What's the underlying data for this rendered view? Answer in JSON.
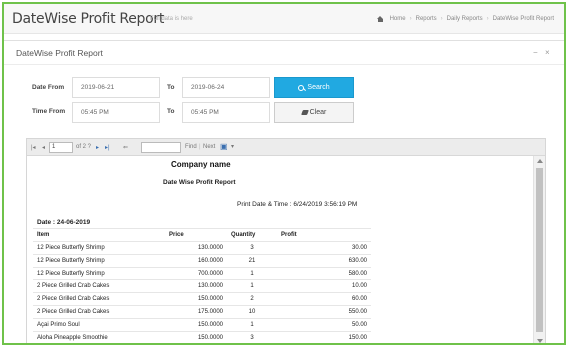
{
  "page": {
    "title": "DateWise Profit Report",
    "subtitle": "Full data is here"
  },
  "breadcrumb": [
    "Home",
    "Reports",
    "Daily Reports",
    "DateWise Profit Report"
  ],
  "panel": {
    "title": "DateWise Profit Report",
    "collapse_symbol": "−",
    "close_symbol": "×"
  },
  "form": {
    "date_from_label": "Date From",
    "date_from_value": "2019-06-21",
    "date_to_label": "To",
    "date_to_value": "2019-06-24",
    "time_from_label": "Time From",
    "time_from_value": "05:45 PM",
    "time_to_label": "To",
    "time_to_value": "05:45 PM",
    "search_label": "Search",
    "clear_label": "Clear"
  },
  "viewer_toolbar": {
    "current_page": "1",
    "page_of": "of 2 ?",
    "find_label": "Find",
    "next_label": "Next"
  },
  "report": {
    "company": "Company name",
    "title": "Date Wise Profit Report",
    "print_date": "Print Date & Time : 6/24/2019 3:56:19 PM",
    "date_header": "Date : 24-06-2019",
    "columns": [
      "Item",
      "Price",
      "Quantity",
      "Profit"
    ],
    "rows": [
      {
        "item": "12 Piece Butterfly Shrimp",
        "price": "130.0000",
        "qty": "3",
        "profit": "30.00"
      },
      {
        "item": "12 Piece Butterfly Shrimp",
        "price": "160.0000",
        "qty": "21",
        "profit": "630.00"
      },
      {
        "item": "12 Piece Butterfly Shrimp",
        "price": "700.0000",
        "qty": "1",
        "profit": "580.00"
      },
      {
        "item": "2 Piece Grilled Crab Cakes",
        "price": "130.0000",
        "qty": "1",
        "profit": "10.00"
      },
      {
        "item": "2 Piece Grilled Crab Cakes",
        "price": "150.0000",
        "qty": "2",
        "profit": "60.00"
      },
      {
        "item": "2 Piece Grilled Crab Cakes",
        "price": "175.0000",
        "qty": "10",
        "profit": "550.00"
      },
      {
        "item": "Açai Primo Soul",
        "price": "150.0000",
        "qty": "1",
        "profit": "50.00"
      },
      {
        "item": "Aloha Pineapple Smoothie",
        "price": "150.0000",
        "qty": "3",
        "profit": "150.00"
      }
    ]
  },
  "colors": {
    "accent": "#21a9e1",
    "frame_border": "#6fc24a"
  }
}
